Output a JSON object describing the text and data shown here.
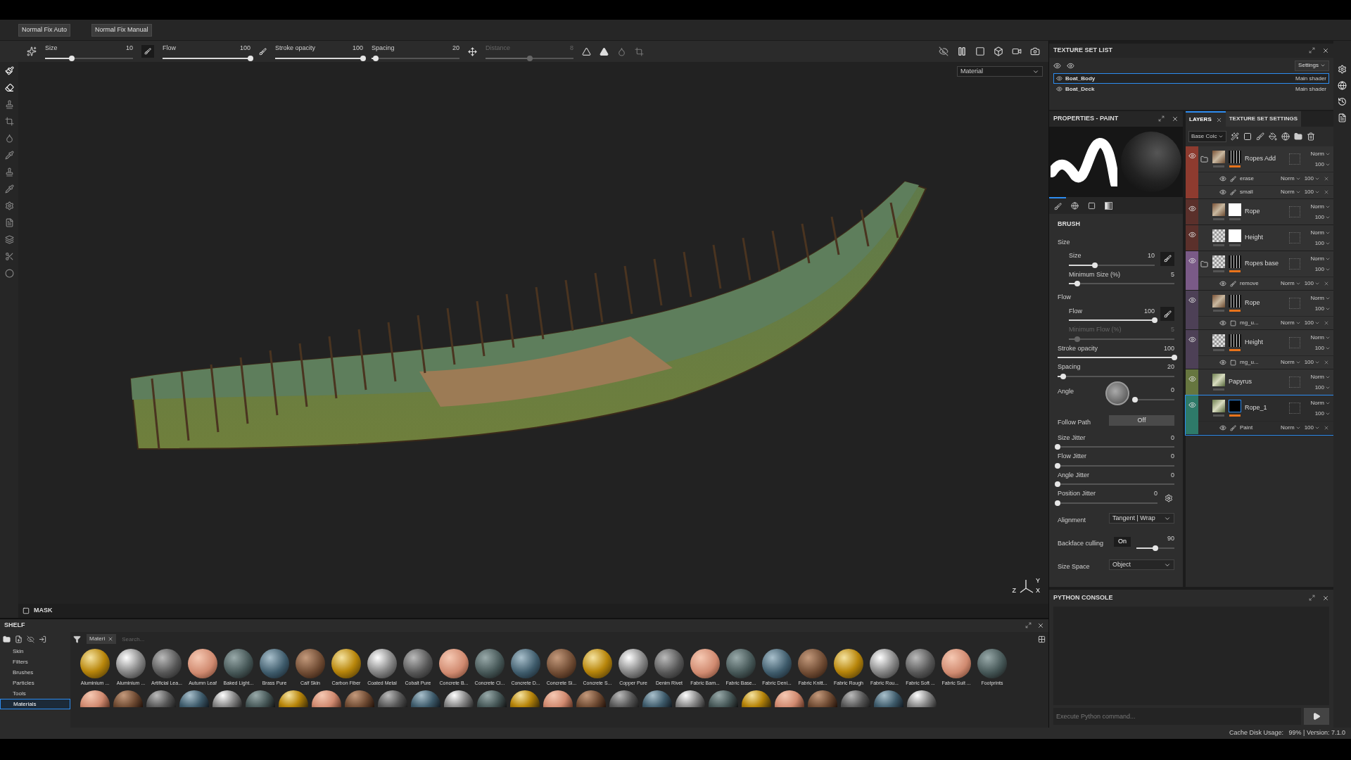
{
  "top_buttons": [
    "Normal Fix Auto",
    "Normal Fix Manual"
  ],
  "tool_options": [
    {
      "label": "Size",
      "value": "10",
      "level": 0.3,
      "disabled": false
    },
    {
      "label": "Flow",
      "value": "100",
      "level": 1,
      "disabled": false
    },
    {
      "label": "Stroke opacity",
      "value": "100",
      "level": 1,
      "disabled": false
    },
    {
      "label": "Spacing",
      "value": "20",
      "level": 0.05,
      "disabled": false
    },
    {
      "label": "Distance",
      "value": "8",
      "level": 0.5,
      "disabled": true
    }
  ],
  "viewport": {
    "channel_dropdown": "Material",
    "axes": [
      "Y",
      "Z",
      "X"
    ]
  },
  "mask_bar": {
    "label": "MASK"
  },
  "shelf": {
    "title": "SHELF",
    "filter_tab": "Materi",
    "search_placeholder": "Search...",
    "categories": [
      {
        "label": "Skin",
        "selected": false
      },
      {
        "label": "Filters",
        "selected": false
      },
      {
        "label": "Brushes",
        "selected": false
      },
      {
        "label": "Particles",
        "selected": false
      },
      {
        "label": "Tools",
        "selected": false
      },
      {
        "label": "Materials",
        "selected": true
      }
    ],
    "materials": [
      "Aluminium ...",
      "Aluminium ...",
      "Artificial Lea...",
      "Autumn Leaf",
      "Baked Light...",
      "Brass Pure",
      "Calf Skin",
      "Carbon Fiber",
      "Coated Metal",
      "Cobalt Pure",
      "Concrete B...",
      "Concrete Cl...",
      "Concrete D...",
      "Concrete Si...",
      "Concrete S...",
      "Copper Pure",
      "Denim Rivet",
      "Fabric Bam...",
      "Fabric Base...",
      "Fabric Deni...",
      "Fabric Knitt...",
      "Fabric Rough",
      "Fabric Rou...",
      "Fabric Soft ...",
      "Fabric Suit ...",
      "Footprints"
    ]
  },
  "texture_set_list": {
    "title": "TEXTURE SET LIST",
    "settings": "Settings",
    "items": [
      {
        "name": "Boat_Body",
        "shader": "Main shader",
        "selected": true
      },
      {
        "name": "Boat_Deck",
        "shader": "Main shader",
        "selected": false
      }
    ]
  },
  "properties": {
    "title": "PROPERTIES - PAINT",
    "section": "BRUSH",
    "rows": [
      {
        "kind": "group",
        "label": "Size",
        "children": [
          {
            "kind": "slider",
            "label": "Size",
            "value": "10",
            "level": 0.3,
            "disabled": false,
            "pressure_button": true
          },
          {
            "kind": "slider",
            "label": "Minimum Size (%)",
            "value": "5",
            "level": 0.08,
            "disabled": false
          }
        ]
      },
      {
        "kind": "group",
        "label": "Flow",
        "children": [
          {
            "kind": "slider",
            "label": "Flow",
            "value": "100",
            "level": 1,
            "disabled": false,
            "pressure_button": true
          },
          {
            "kind": "slider",
            "label": "Minimum Flow (%)",
            "value": "5",
            "level": 0.08,
            "disabled": true
          }
        ]
      },
      {
        "kind": "slider",
        "label": "Stroke opacity",
        "value": "100",
        "level": 1,
        "disabled": false
      },
      {
        "kind": "slider",
        "label": "Spacing",
        "value": "20",
        "level": 0.05,
        "disabled": false
      },
      {
        "kind": "angle",
        "label": "Angle",
        "value": "0",
        "level": 0
      },
      {
        "kind": "toggle",
        "label": "Follow Path",
        "value": "Off",
        "on": false
      },
      {
        "kind": "slider",
        "label": "Size Jitter",
        "value": "0",
        "level": 0,
        "disabled": false
      },
      {
        "kind": "slider",
        "label": "Flow Jitter",
        "value": "0",
        "level": 0,
        "disabled": false
      },
      {
        "kind": "slider",
        "label": "Angle Jitter",
        "value": "0",
        "level": 0,
        "disabled": false
      },
      {
        "kind": "slider",
        "label": "Position Jitter",
        "value": "0",
        "level": 0,
        "disabled": false,
        "settings_button": true
      },
      {
        "kind": "dropdown",
        "label": "Alignment",
        "value": "Tangent | Wrap"
      },
      {
        "kind": "backface",
        "label": "Backface culling",
        "toggle": "On",
        "on": true,
        "value": "90",
        "level": 0.5
      },
      {
        "kind": "dropdown",
        "label": "Size Space",
        "value": "Object"
      }
    ]
  },
  "layers_panel": {
    "tabs": [
      {
        "label": "LAYERS",
        "selected": true
      },
      {
        "label": "TEXTURE SET SETTINGS",
        "selected": false
      }
    ],
    "channel": "Base Colc",
    "layers": [
      {
        "name": "Ropes Add",
        "color": "#8e3b2f",
        "folder": true,
        "thumbnail": {
          "kind": "material"
        },
        "mask": {
          "kind": "pattern"
        },
        "blend": "Norm",
        "opacity": "100",
        "selected": false,
        "effects": [
          {
            "name": "erase",
            "kind": "paint",
            "blend": "Norm",
            "opacity": "100"
          },
          {
            "name": "small",
            "kind": "paint",
            "blend": "Norm",
            "opacity": "100"
          }
        ]
      },
      {
        "name": "Rope",
        "color": "#5b302b",
        "folder": false,
        "thumbnail": {
          "kind": "material"
        },
        "mask": {
          "kind": "white"
        },
        "blend": "Norm",
        "opacity": "100",
        "selected": false
      },
      {
        "name": "Height",
        "color": "#5b302b",
        "folder": false,
        "thumbnail": {
          "kind": "checker"
        },
        "mask": {
          "kind": "white"
        },
        "blend": "Norm",
        "opacity": "100",
        "selected": false
      },
      {
        "name": "Ropes base",
        "color": "#7a5a87",
        "folder": true,
        "thumbnail": {
          "kind": "checker"
        },
        "mask": {
          "kind": "pattern"
        },
        "blend": "Norm",
        "opacity": "100",
        "selected": false,
        "effects": [
          {
            "name": "remove",
            "kind": "paint",
            "blend": "Norm",
            "opacity": "100"
          }
        ]
      },
      {
        "name": "Rope",
        "color": "#4d4056",
        "folder": false,
        "thumbnail": {
          "kind": "material"
        },
        "mask": {
          "kind": "pattern"
        },
        "blend": "Norm",
        "opacity": "100",
        "selected": false,
        "effects": [
          {
            "name": "mg_u...",
            "kind": "generator",
            "blend": "Norm",
            "opacity": "100"
          }
        ]
      },
      {
        "name": "Height",
        "color": "#4d4056",
        "folder": false,
        "thumbnail": {
          "kind": "checker"
        },
        "mask": {
          "kind": "pattern"
        },
        "blend": "Norm",
        "opacity": "100",
        "selected": false,
        "effects": [
          {
            "name": "mg_u...",
            "kind": "generator",
            "blend": "Norm",
            "opacity": "100"
          }
        ]
      },
      {
        "name": "Papyrus",
        "color": "#66763f",
        "folder": false,
        "thumbnail": {
          "kind": "papyrus"
        },
        "blend": "Norm",
        "opacity": "100",
        "selected": false
      },
      {
        "name": "Rope_1",
        "color": "#2e7a69",
        "folder": false,
        "thumbnail": {
          "kind": "papyrus"
        },
        "mask": {
          "kind": "black"
        },
        "blend": "Norm",
        "opacity": "100",
        "selected": true,
        "effects": [
          {
            "name": "Paint",
            "kind": "paint",
            "blend": "Norm",
            "opacity": "100"
          }
        ]
      }
    ]
  },
  "python_console": {
    "title": "PYTHON CONSOLE",
    "placeholder": "Execute Python command..."
  },
  "status_bar": {
    "text": "Cache Disk Usage:   99% | Version: 7.1.0"
  }
}
